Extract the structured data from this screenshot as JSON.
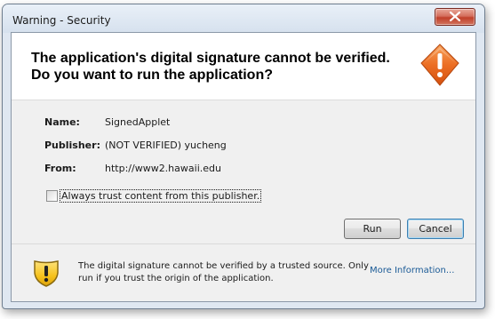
{
  "window": {
    "title": "Warning - Security"
  },
  "header": {
    "line1": "The application's digital signature cannot be verified.",
    "line2": "Do you want to run the application?",
    "icon": "warning-shield-icon"
  },
  "details": {
    "name_label": "Name:",
    "name_value": "SignedApplet",
    "publisher_label": "Publisher:",
    "publisher_value": "(NOT VERIFIED) yucheng",
    "from_label": "From:",
    "from_value": "http://www2.hawaii.edu"
  },
  "trust_checkbox": {
    "label": "Always trust content from this publisher.",
    "checked": false
  },
  "buttons": {
    "run": "Run",
    "cancel": "Cancel"
  },
  "footer": {
    "line1": "The digital signature cannot be verified by a trusted source.  Only",
    "line2": "run if you trust the origin of the application.",
    "more_info": "More Information...",
    "icon": "yellow-warning-shield-icon"
  },
  "colors": {
    "link": "#1a5a96",
    "header_icon": "#e0601c",
    "footer_icon": "#f5c518"
  }
}
